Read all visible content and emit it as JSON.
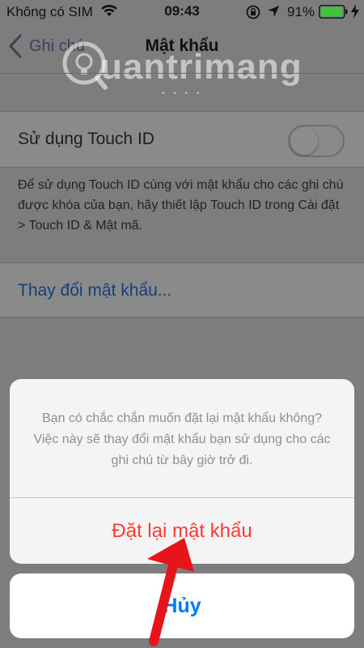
{
  "status_bar": {
    "carrier": "Không có SIM",
    "time": "09:43",
    "battery_percent": "91%",
    "icons": [
      "wifi-icon",
      "rotation-lock-icon",
      "location-icon",
      "battery-icon",
      "charging-icon"
    ]
  },
  "nav": {
    "back_label": "Ghi chú",
    "title": "Mật khẩu"
  },
  "watermark": {
    "text": "uantrimang"
  },
  "settings": {
    "touch_id_label": "Sử dụng Touch ID",
    "touch_id_enabled": false,
    "touch_id_note": "Để sử dụng Touch ID cùng với mật khẩu cho các ghi chú được khóa của bạn, hãy thiết lập Touch ID trong Cài đặt > Touch ID & Mật mã.",
    "change_password_label": "Thay đổi mật khẩu..."
  },
  "action_sheet": {
    "message": "Bạn có chắc chắn muốn đặt lại mật khẩu không? Việc này sẽ thay đổi mật khẩu bạn sử dụng cho các ghi chú từ bây giờ trở đi.",
    "reset_label": "Đặt lại mật khẩu",
    "cancel_label": "Hủy"
  },
  "colors": {
    "destructive": "#ff3b30",
    "ios_blue": "#007aff",
    "annotation_arrow": "#e8141c"
  }
}
